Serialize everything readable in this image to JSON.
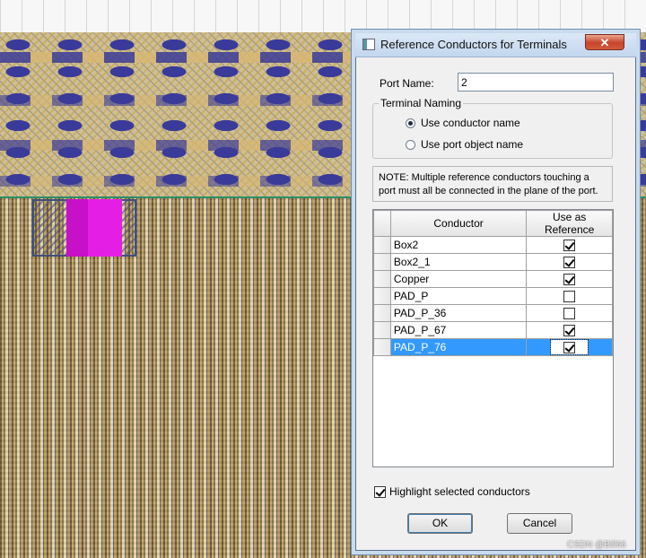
{
  "dialog": {
    "title": "Reference Conductors for Terminals",
    "close_label": "✕",
    "port_name_label": "Port Name:",
    "port_name_value": "2",
    "terminal_naming": {
      "legend": "Terminal Naming",
      "options": [
        {
          "label": "Use conductor name",
          "selected": true
        },
        {
          "label": "Use port object name",
          "selected": false
        }
      ]
    },
    "note": "NOTE: Multiple reference conductors touching a port must all be connected in the plane of the port.",
    "grid": {
      "columns": [
        "Conductor",
        "Use as Reference"
      ],
      "rows": [
        {
          "conductor": "Box2",
          "use_as_reference": true
        },
        {
          "conductor": "Box2_1",
          "use_as_reference": true
        },
        {
          "conductor": "Copper",
          "use_as_reference": true
        },
        {
          "conductor": "PAD_P",
          "use_as_reference": false
        },
        {
          "conductor": "PAD_P_36",
          "use_as_reference": false
        },
        {
          "conductor": "PAD_P_67",
          "use_as_reference": true
        },
        {
          "conductor": "PAD_P_76",
          "use_as_reference": true,
          "selected": true
        }
      ]
    },
    "highlight_label": "Highlight selected conductors",
    "highlight_checked": true,
    "ok_label": "OK",
    "cancel_label": "Cancel"
  },
  "watermark": "CSDN @Bill66",
  "colors": {
    "selection": "#3399ff",
    "port_highlight": "#e51ee5",
    "title_close": "#c8442b"
  }
}
